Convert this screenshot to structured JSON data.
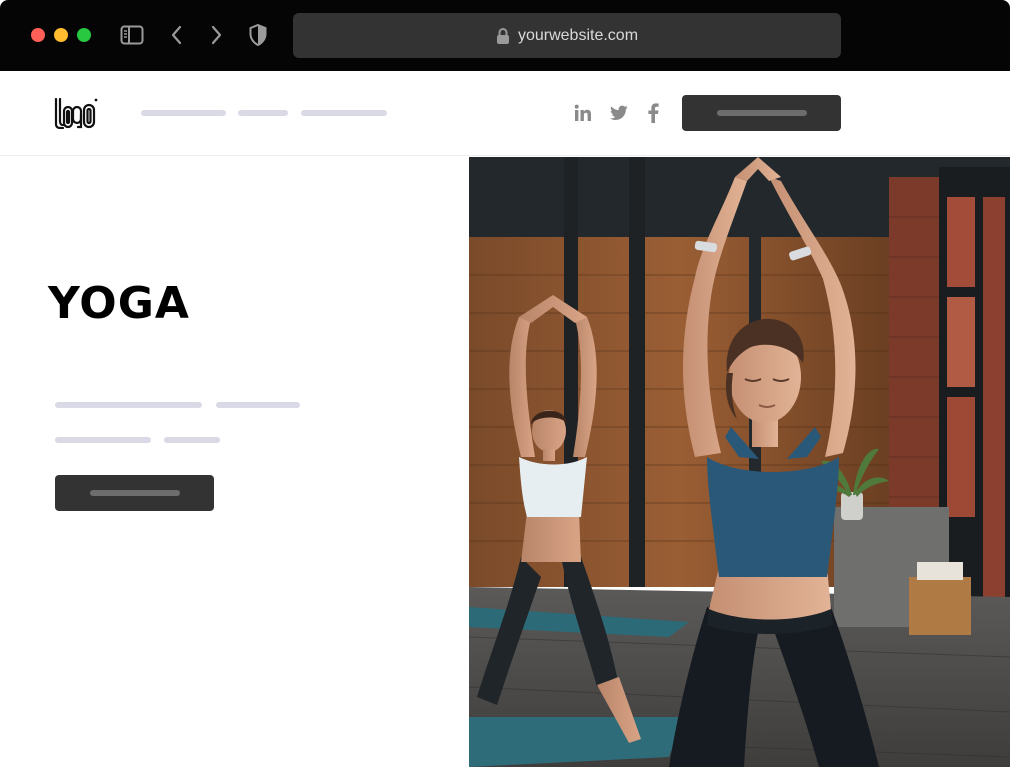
{
  "browser": {
    "url": "yourwebsite.com",
    "icons": [
      "sidebar-icon",
      "back-arrow-icon",
      "forward-arrow-icon",
      "shield-icon",
      "lock-icon"
    ]
  },
  "header": {
    "logo_text": "LOGO",
    "social": [
      "linkedin-icon",
      "twitter-icon",
      "facebook-icon"
    ]
  },
  "hero": {
    "title": "YOGA"
  },
  "colors": {
    "chrome": "#050505",
    "address_bar": "#333333",
    "button": "#333333",
    "placeholder_line": "#d9dae5",
    "traffic_red": "#fe5f57",
    "traffic_yellow": "#febc2e",
    "traffic_green": "#28c840"
  }
}
